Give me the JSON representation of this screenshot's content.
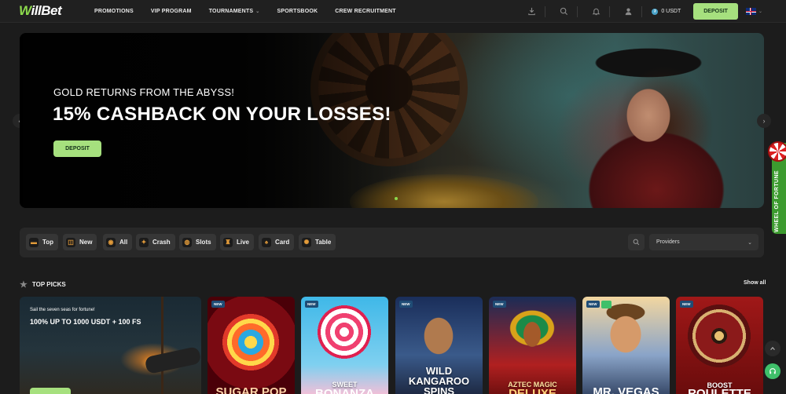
{
  "header": {
    "logo_w": "W",
    "logo_rest": "illBet",
    "nav": [
      {
        "label": "PROMOTIONS"
      },
      {
        "label": "VIP PROGRAM"
      },
      {
        "label": "TOURNAMENTS",
        "dropdown": true
      },
      {
        "label": "SPORTSBOOK"
      },
      {
        "label": "CREW RECRUITMENT"
      }
    ],
    "balance": "0 USDT",
    "deposit_label": "DEPOSIT",
    "language": "EN",
    "icons": [
      "download-icon",
      "search-icon",
      "bell-icon",
      "user-icon"
    ]
  },
  "hero": {
    "subtitle": "GOLD RETURNS FROM THE ABYSS!",
    "title": "15% CASHBACK ON YOUR LOSSES!",
    "button_label": "DEPOSIT",
    "prev_arrow": "‹",
    "next_arrow": "›"
  },
  "wheel_of_fortune": {
    "label": "WHEEL OF FORTUNE"
  },
  "filters": {
    "categories": [
      {
        "label": "Top",
        "icon": "chest-icon"
      },
      {
        "label": "New",
        "icon": "new-icon"
      },
      {
        "label": "All",
        "icon": "all-icon"
      },
      {
        "label": "Crash",
        "icon": "crash-icon"
      },
      {
        "label": "Slots",
        "icon": "slots-icon"
      },
      {
        "label": "Live",
        "icon": "live-icon"
      },
      {
        "label": "Card",
        "icon": "card-icon"
      },
      {
        "label": "Table",
        "icon": "table-icon"
      }
    ],
    "providers_placeholder": "Providers"
  },
  "top_picks": {
    "title": "TOP PICKS",
    "show_all": "Show all",
    "promo": {
      "subtitle": "Sail the seven seas for fortune!",
      "title": "100% UP TO 1000 USDT + 100 FS"
    },
    "games": [
      {
        "badge": "NEW",
        "line1": "SUGAR POP",
        "line2": ""
      },
      {
        "badge": "NEW",
        "line1": "SWEET",
        "line2": "BONANZA"
      },
      {
        "badge": "NEW",
        "line1": "WILD",
        "line2": "KANGAROO",
        "line3": "SPINS"
      },
      {
        "badge": "NEW",
        "line1": "AZTEC MAGIC",
        "line2": "DELUXE"
      },
      {
        "badge": "NEW",
        "line1": "MR. VEGAS",
        "line2": ""
      },
      {
        "badge": "NEW",
        "line1": "BOOST",
        "line2": "ROULETTE"
      }
    ]
  }
}
